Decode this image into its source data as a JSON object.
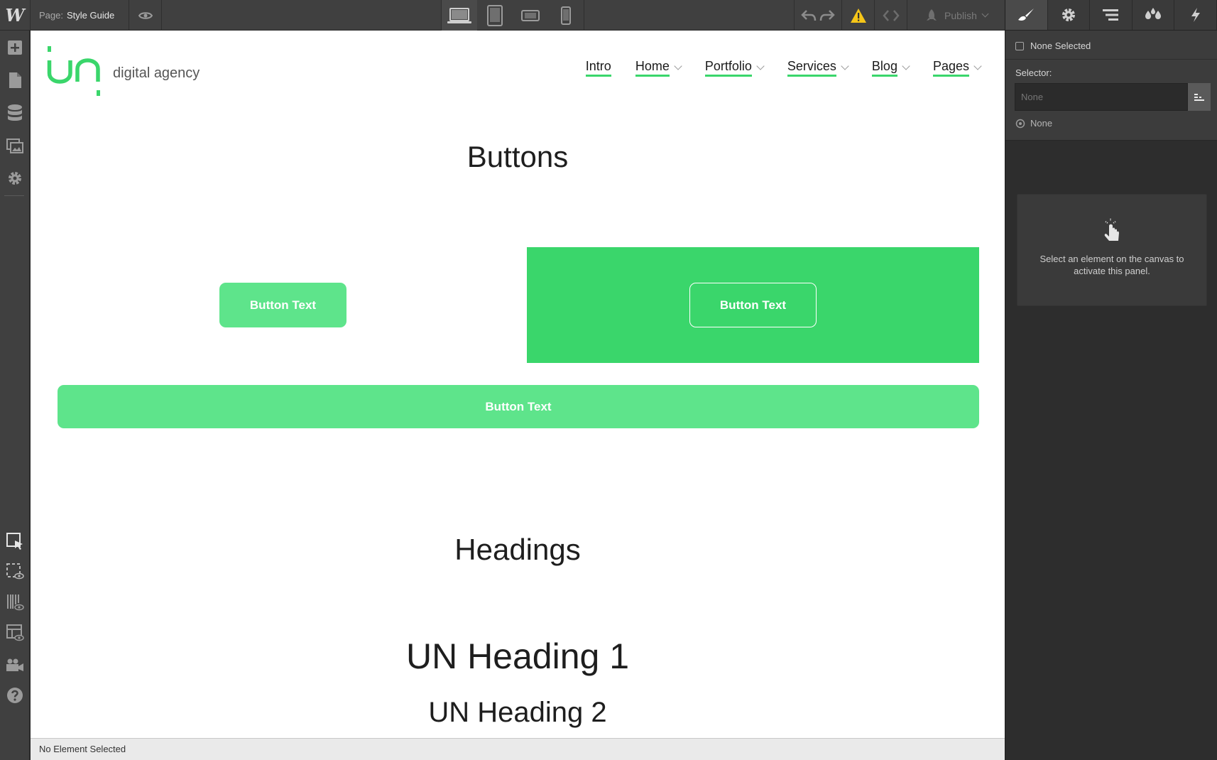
{
  "topbar": {
    "logo": "W",
    "page_label": "Page:",
    "page_name": "Style Guide",
    "publish_label": "Publish"
  },
  "canvas": {
    "brand_text": "digital agency",
    "nav": [
      {
        "label": "Intro",
        "dropdown": false
      },
      {
        "label": "Home",
        "dropdown": true
      },
      {
        "label": "Portfolio",
        "dropdown": true
      },
      {
        "label": "Services",
        "dropdown": true
      },
      {
        "label": "Blog",
        "dropdown": true
      },
      {
        "label": "Pages",
        "dropdown": true
      }
    ],
    "buttons_title": "Buttons",
    "button_primary": "Button Text",
    "button_outline": "Button Text",
    "button_wide": "Button Text",
    "headings_title": "Headings",
    "heading1": "UN Heading 1",
    "heading2": "UN Heading 2"
  },
  "status_bar": {
    "text": "No Element Selected"
  },
  "right_panel": {
    "tabs": [
      "style-brush-icon",
      "settings-gear-icon",
      "navigator-icon",
      "swatches-icon",
      "interactions-bolt-icon"
    ],
    "none_selected": "None Selected",
    "selector_label": "Selector:",
    "selector_placeholder": "None",
    "selector_state": "None",
    "empty_message": "Select an element on the canvas to activate this panel."
  },
  "colors": {
    "accent_green": "#3ad66b",
    "button_green": "#5ee48b",
    "warning_yellow": "#f5c518",
    "chrome_dark": "#404040"
  }
}
